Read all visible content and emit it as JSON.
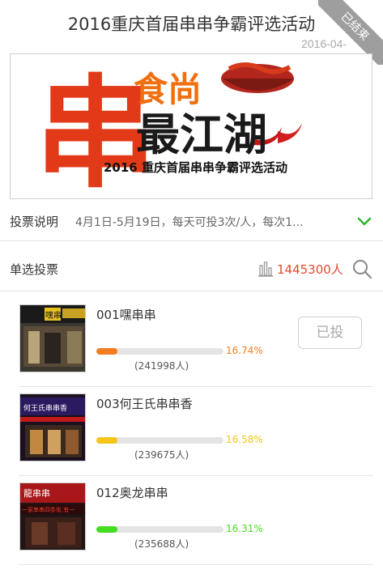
{
  "header": {
    "title": "2016重庆首届串串争霸评选活动",
    "date": "2016-04-",
    "status_ribbon": "已结束"
  },
  "banner": {
    "big_char": "串",
    "line1": "食尚",
    "line2": "最江湖",
    "subtitle": "2016 重庆首届串串争霸评选活动"
  },
  "description": {
    "label": "投票说明",
    "text": "4月1日-5月19日，每天可投3次/人，每次1..."
  },
  "voting": {
    "mode_label": "单选投票",
    "total": "1445300人",
    "accent_color": "#e2492f"
  },
  "items": [
    {
      "name": "001嘿串串",
      "percent": "16.74%",
      "votes": "(241998人)",
      "fraction": 0.167,
      "bar_color": "#f47b20",
      "sign_text": "嘿串",
      "button": "已投"
    },
    {
      "name": "003何王氏串串香",
      "percent": "16.58%",
      "votes": "(239675人)",
      "fraction": 0.166,
      "bar_color": "#f5c518",
      "sign_text": "何王氏串串香"
    },
    {
      "name": "012奥龙串串",
      "percent": "16.31%",
      "votes": "(235688人)",
      "fraction": 0.163,
      "bar_color": "#44dd22",
      "sign_text": "龍串串",
      "sign_text2": "一家串串四条街,有一"
    }
  ]
}
